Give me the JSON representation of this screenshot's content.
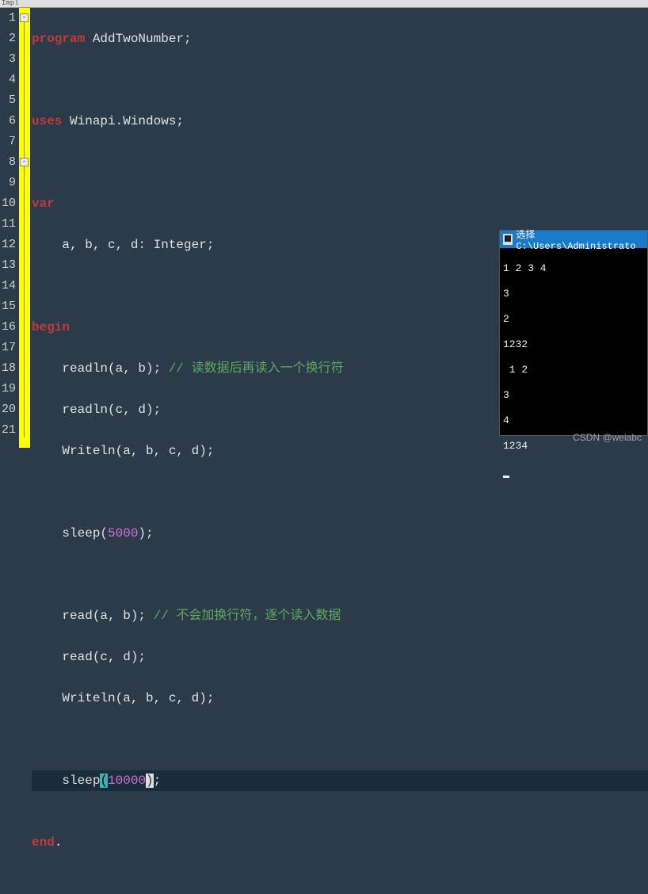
{
  "toolbar": {
    "impl_label": "Impl"
  },
  "gutter": [
    "1",
    "2",
    "3",
    "4",
    "5",
    "6",
    "7",
    "8",
    "9",
    "10",
    "11",
    "12",
    "13",
    "14",
    "15",
    "16",
    "17",
    "18",
    "19",
    "20",
    "21"
  ],
  "code": {
    "l1": {
      "kw": "program",
      "rest": " AddTwoNumber;"
    },
    "l3": {
      "kw": "uses",
      "rest": " Winapi.Windows;"
    },
    "l5": {
      "kw": "var"
    },
    "l6": "    a, b, c, d: Integer;",
    "l8": {
      "kw": "begin"
    },
    "l9": {
      "code": "    readln(a, b); ",
      "cm": "// 读数据后再读入一个换行符"
    },
    "l10": "    readln(c, d);",
    "l11": "    Writeln(a, b, c, d);",
    "l13": {
      "pre": "    sleep(",
      "num": "5000",
      "post": ");"
    },
    "l15": {
      "code": "    read(a, b); ",
      "cm": "// 不会加换行符，逐个读入数据"
    },
    "l16": "    read(c, d);",
    "l17": "    Writeln(a, b, c, d);",
    "l19": {
      "pre": "    sleep",
      "lb": "(",
      "num": "10000",
      "rb": ")",
      "post": ";"
    },
    "l21": {
      "kw": "end",
      "dot": "."
    }
  },
  "console": {
    "title": "选择 C:\\Users\\Administrato",
    "lines": [
      "1 2 3 4",
      "3",
      "2",
      "1232",
      " 1 2",
      "3",
      "4",
      "1234"
    ]
  },
  "watermark": "CSDN @weiabc"
}
